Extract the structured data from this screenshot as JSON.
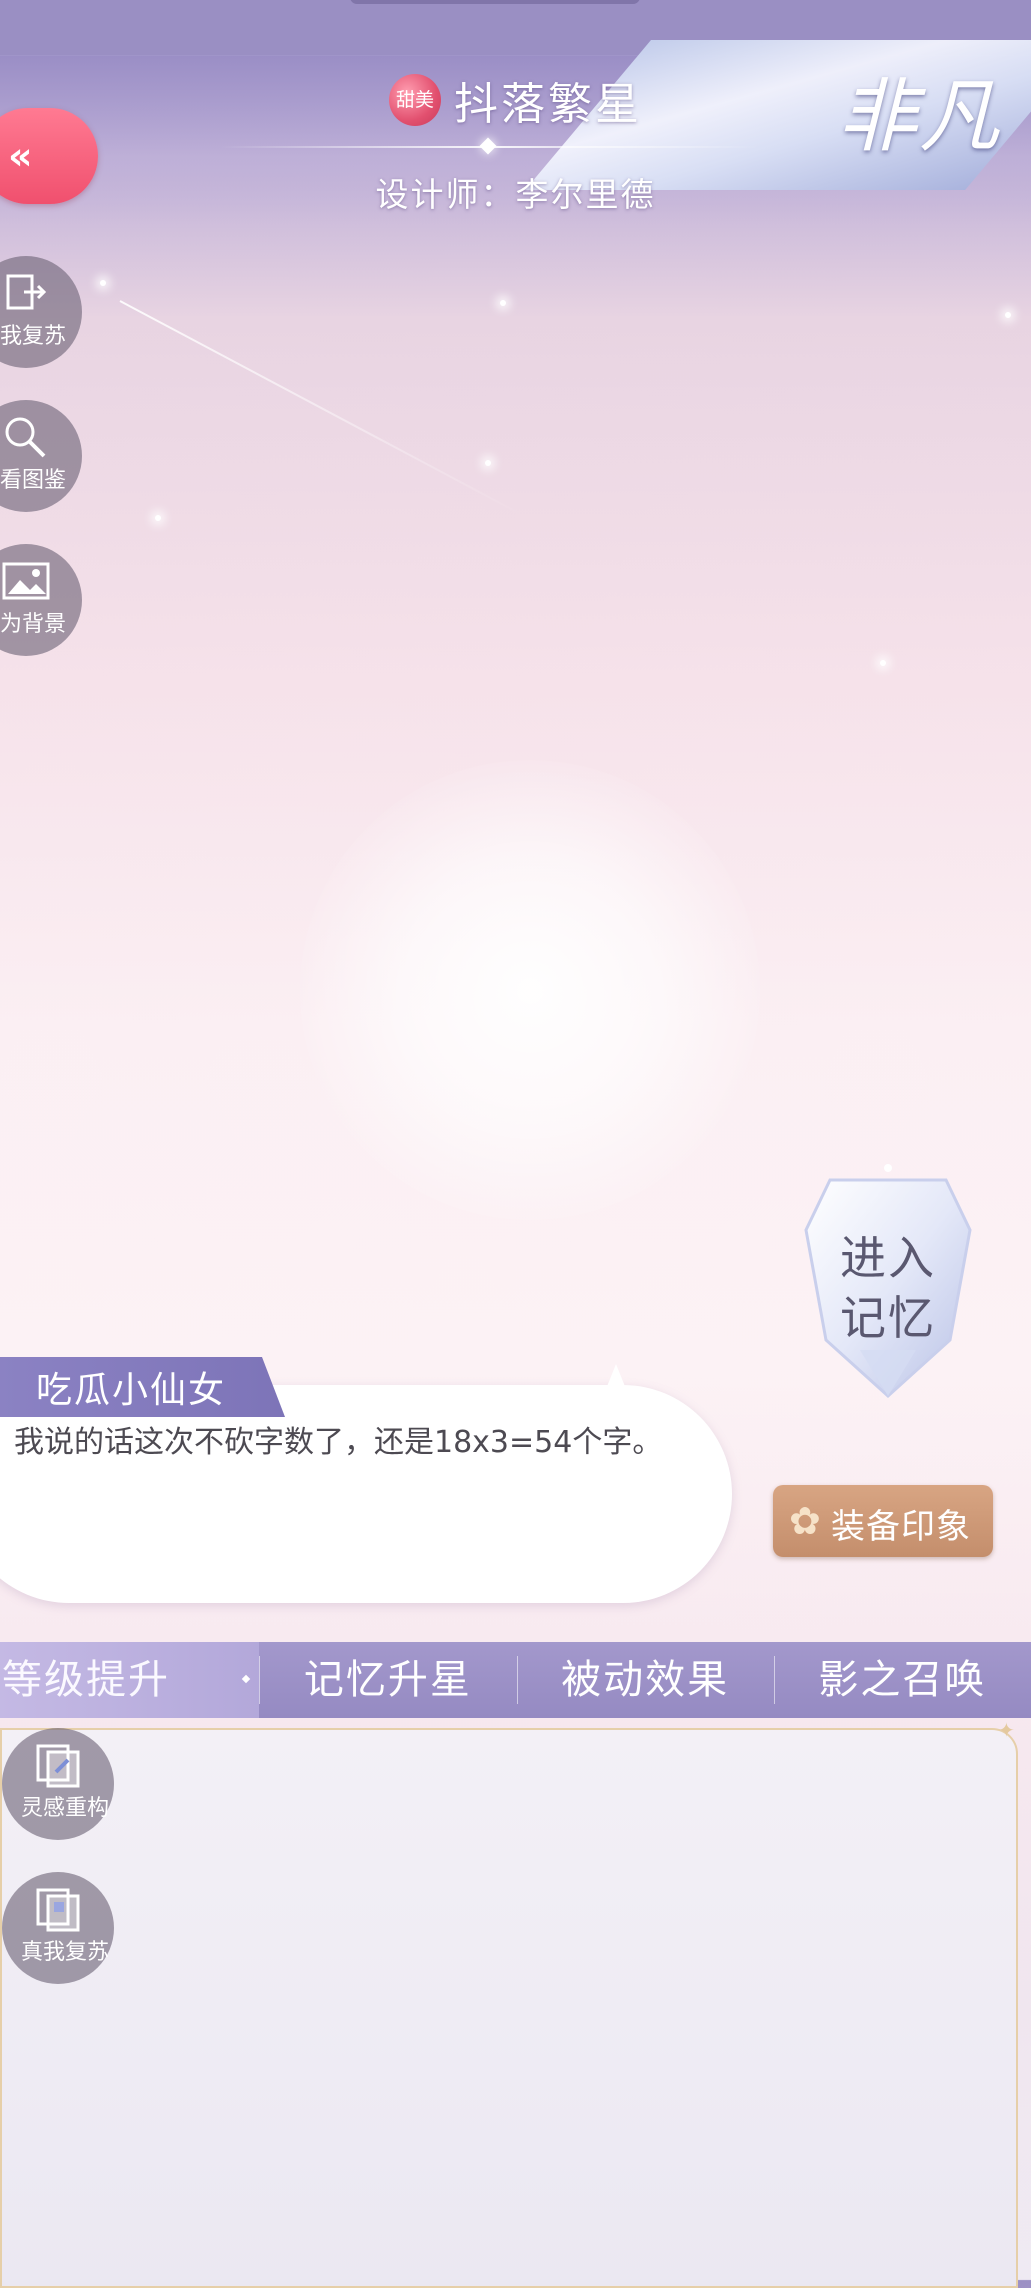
{
  "header": {
    "rarity_badge": "甜美",
    "title": "抖落繁星",
    "designer": "设计师：李尔里德",
    "rarity_label": "非凡"
  },
  "back_button": {
    "icon": "double-chevron-left-icon",
    "symbol": "«"
  },
  "side_buttons_top": [
    {
      "label": "我复苏",
      "icon": "revive-icon"
    },
    {
      "label": "看图鉴",
      "icon": "magnifier-icon"
    },
    {
      "label": "为背景",
      "icon": "picture-icon"
    }
  ],
  "memory_button": {
    "line1": "进入",
    "line2": "记忆"
  },
  "dialogue": {
    "speaker": "吃瓜小仙女",
    "text": "我说的话这次不砍字数了，还是18x3=54个字。"
  },
  "impression_button": {
    "label": "装备印象",
    "icon": "flower-icon"
  },
  "tabs": [
    {
      "label": "等级提升",
      "active": true
    },
    {
      "label": "记忆升星",
      "active": false
    },
    {
      "label": "被动效果",
      "active": false
    },
    {
      "label": "影之召唤",
      "active": false
    }
  ],
  "side_buttons_bottom": [
    {
      "label": "灵感重构",
      "icon": "inspiration-icon"
    },
    {
      "label": "真我复苏",
      "icon": "true-self-icon"
    }
  ],
  "colors": {
    "accent_pink": "#f0506e",
    "tab_bar": "#958ac2",
    "impression_gold": "#c48e6c",
    "panel_border": "#e6cfa9"
  }
}
